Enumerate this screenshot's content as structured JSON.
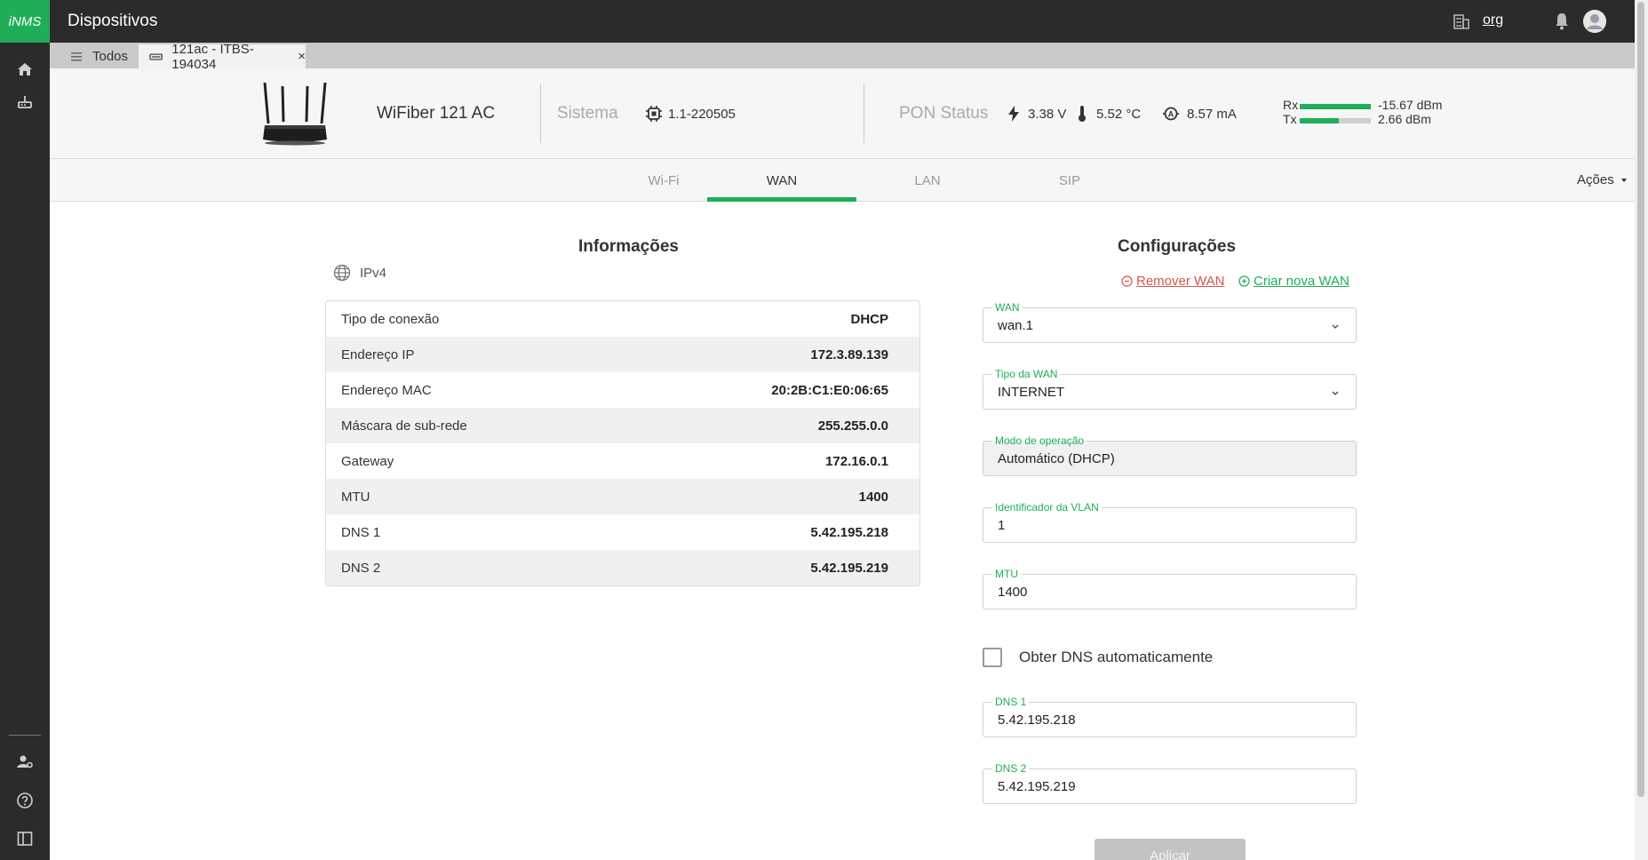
{
  "app": {
    "logo": "iNMS",
    "title": "Dispositivos",
    "org": "org"
  },
  "tabs": {
    "all_label": "Todos",
    "device_label": "121ac - ITBS-194034",
    "close": "×"
  },
  "device": {
    "model": "WiFiber 121 AC",
    "sistema_label": "Sistema",
    "firmware": "1.1-220505",
    "pon_label": "PON Status",
    "voltage": "3.38 V",
    "temperature": "5.52 °C",
    "current": "8.57 mA",
    "rx_label": "Rx",
    "rx_value": "-15.67 dBm",
    "rx_level": 1.0,
    "tx_label": "Tx",
    "tx_value": "2.66 dBm",
    "tx_level": 0.55
  },
  "section_tabs": [
    "Wi-Fi",
    "WAN",
    "LAN",
    "SIP"
  ],
  "active_section": "WAN",
  "actions_label": "Ações",
  "info": {
    "title": "Informações",
    "protocol": "IPv4",
    "rows": [
      {
        "key": "Tipo de conexão",
        "value": "DHCP"
      },
      {
        "key": "Endereço IP",
        "value": "172.3.89.139"
      },
      {
        "key": "Endereço MAC",
        "value": "20:2B:C1:E0:06:65"
      },
      {
        "key": "Máscara de sub-rede",
        "value": "255.255.0.0"
      },
      {
        "key": "Gateway",
        "value": "172.16.0.1"
      },
      {
        "key": "MTU",
        "value": "1400"
      },
      {
        "key": "DNS 1",
        "value": "5.42.195.218"
      },
      {
        "key": "DNS 2",
        "value": "5.42.195.219"
      }
    ]
  },
  "config": {
    "title": "Configurações",
    "remove_wan": "Remover WAN",
    "create_wan": "Criar nova WAN",
    "fields": {
      "wan": {
        "label": "WAN",
        "value": "wan.1"
      },
      "wan_type": {
        "label": "Tipo da WAN",
        "value": "INTERNET"
      },
      "op_mode": {
        "label": "Modo de operação",
        "value": "Automático (DHCP)"
      },
      "vlan": {
        "label": "Identificador da VLAN",
        "value": "1"
      },
      "mtu": {
        "label": "MTU",
        "value": "1400"
      },
      "dns1": {
        "label": "DNS 1",
        "value": "5.42.195.218"
      },
      "dns2": {
        "label": "DNS 2",
        "value": "5.42.195.219"
      }
    },
    "auto_dns_label": "Obter DNS automaticamente",
    "auto_dns_checked": false,
    "apply_label": "Aplicar"
  },
  "colors": {
    "accent": "#1fae57",
    "danger": "#d9534f",
    "topbar": "#2b2b2b"
  }
}
